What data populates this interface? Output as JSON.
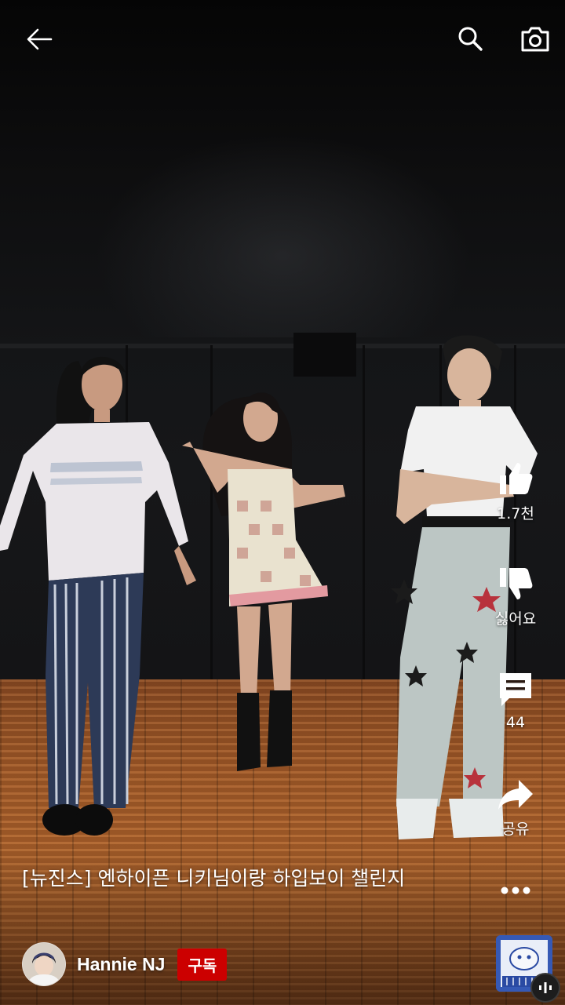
{
  "top_bar": {
    "back_icon": "arrow-left-icon",
    "search_icon": "search-icon",
    "camera_icon": "camera-icon"
  },
  "actions": {
    "like_label": "1.7천",
    "dislike_label": "싫어요",
    "comments_label": "44",
    "share_label": "공유",
    "more_icon": "more-horizontal-icon"
  },
  "video": {
    "title": "[뉴진스] 엔하이픈 니키님이랑 하입보이 챌린지"
  },
  "channel": {
    "name": "Hannie NJ",
    "subscribe_label": "구독"
  },
  "colors": {
    "subscribe_bg": "#cc0000",
    "icon_color": "#ffffff"
  }
}
